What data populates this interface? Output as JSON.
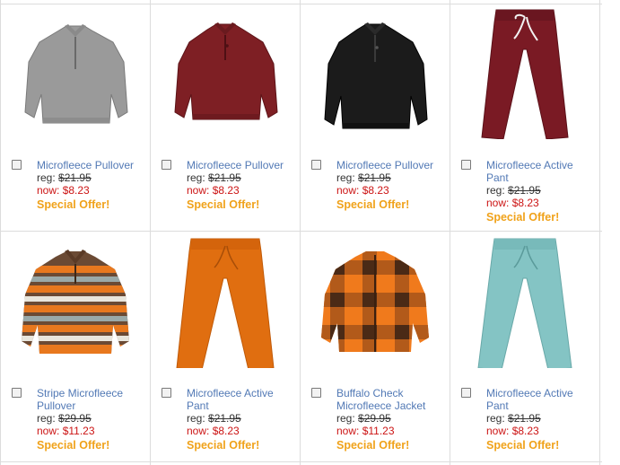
{
  "colors": {
    "link": "#5279b5",
    "sale": "#cc1414",
    "offer": "#f0a21a",
    "divider": "#dcdcdc"
  },
  "products": [
    {
      "name": "Microfleece Pullover",
      "reg_label": "reg:",
      "reg_price": "$21.95",
      "now_label": "now:",
      "now_price": "$8.23",
      "offer": "Special Offer!",
      "image": "gray-pullover-icon"
    },
    {
      "name": "Microfleece Pullover",
      "reg_label": "reg:",
      "reg_price": "$21.95",
      "now_label": "now:",
      "now_price": "$8.23",
      "offer": "Special Offer!",
      "image": "maroon-pullover-icon"
    },
    {
      "name": "Microfleece Pullover",
      "reg_label": "reg:",
      "reg_price": "$21.95",
      "now_label": "now:",
      "now_price": "$8.23",
      "offer": "Special Offer!",
      "image": "black-pullover-icon"
    },
    {
      "name": "Microfleece Active Pant",
      "reg_label": "reg:",
      "reg_price": "$21.95",
      "now_label": "now:",
      "now_price": "$8.23",
      "offer": "Special Offer!",
      "image": "maroon-pants-icon"
    },
    {
      "name": "Stripe Microfleece Pullover",
      "reg_label": "reg:",
      "reg_price": "$29.95",
      "now_label": "now:",
      "now_price": "$11.23",
      "offer": "Special Offer!",
      "image": "striped-pullover-icon"
    },
    {
      "name": "Microfleece Active Pant",
      "reg_label": "reg:",
      "reg_price": "$21.95",
      "now_label": "now:",
      "now_price": "$8.23",
      "offer": "Special Offer!",
      "image": "orange-pants-icon"
    },
    {
      "name": "Buffalo Check Microfleece Jacket",
      "reg_label": "reg:",
      "reg_price": "$29.95",
      "now_label": "now:",
      "now_price": "$11.23",
      "offer": "Special Offer!",
      "image": "buffalo-check-jacket-icon"
    },
    {
      "name": "Microfleece Active Pant",
      "reg_label": "reg:",
      "reg_price": "$21.95",
      "now_label": "now:",
      "now_price": "$8.23",
      "offer": "Special Offer!",
      "image": "aqua-pants-icon"
    }
  ]
}
